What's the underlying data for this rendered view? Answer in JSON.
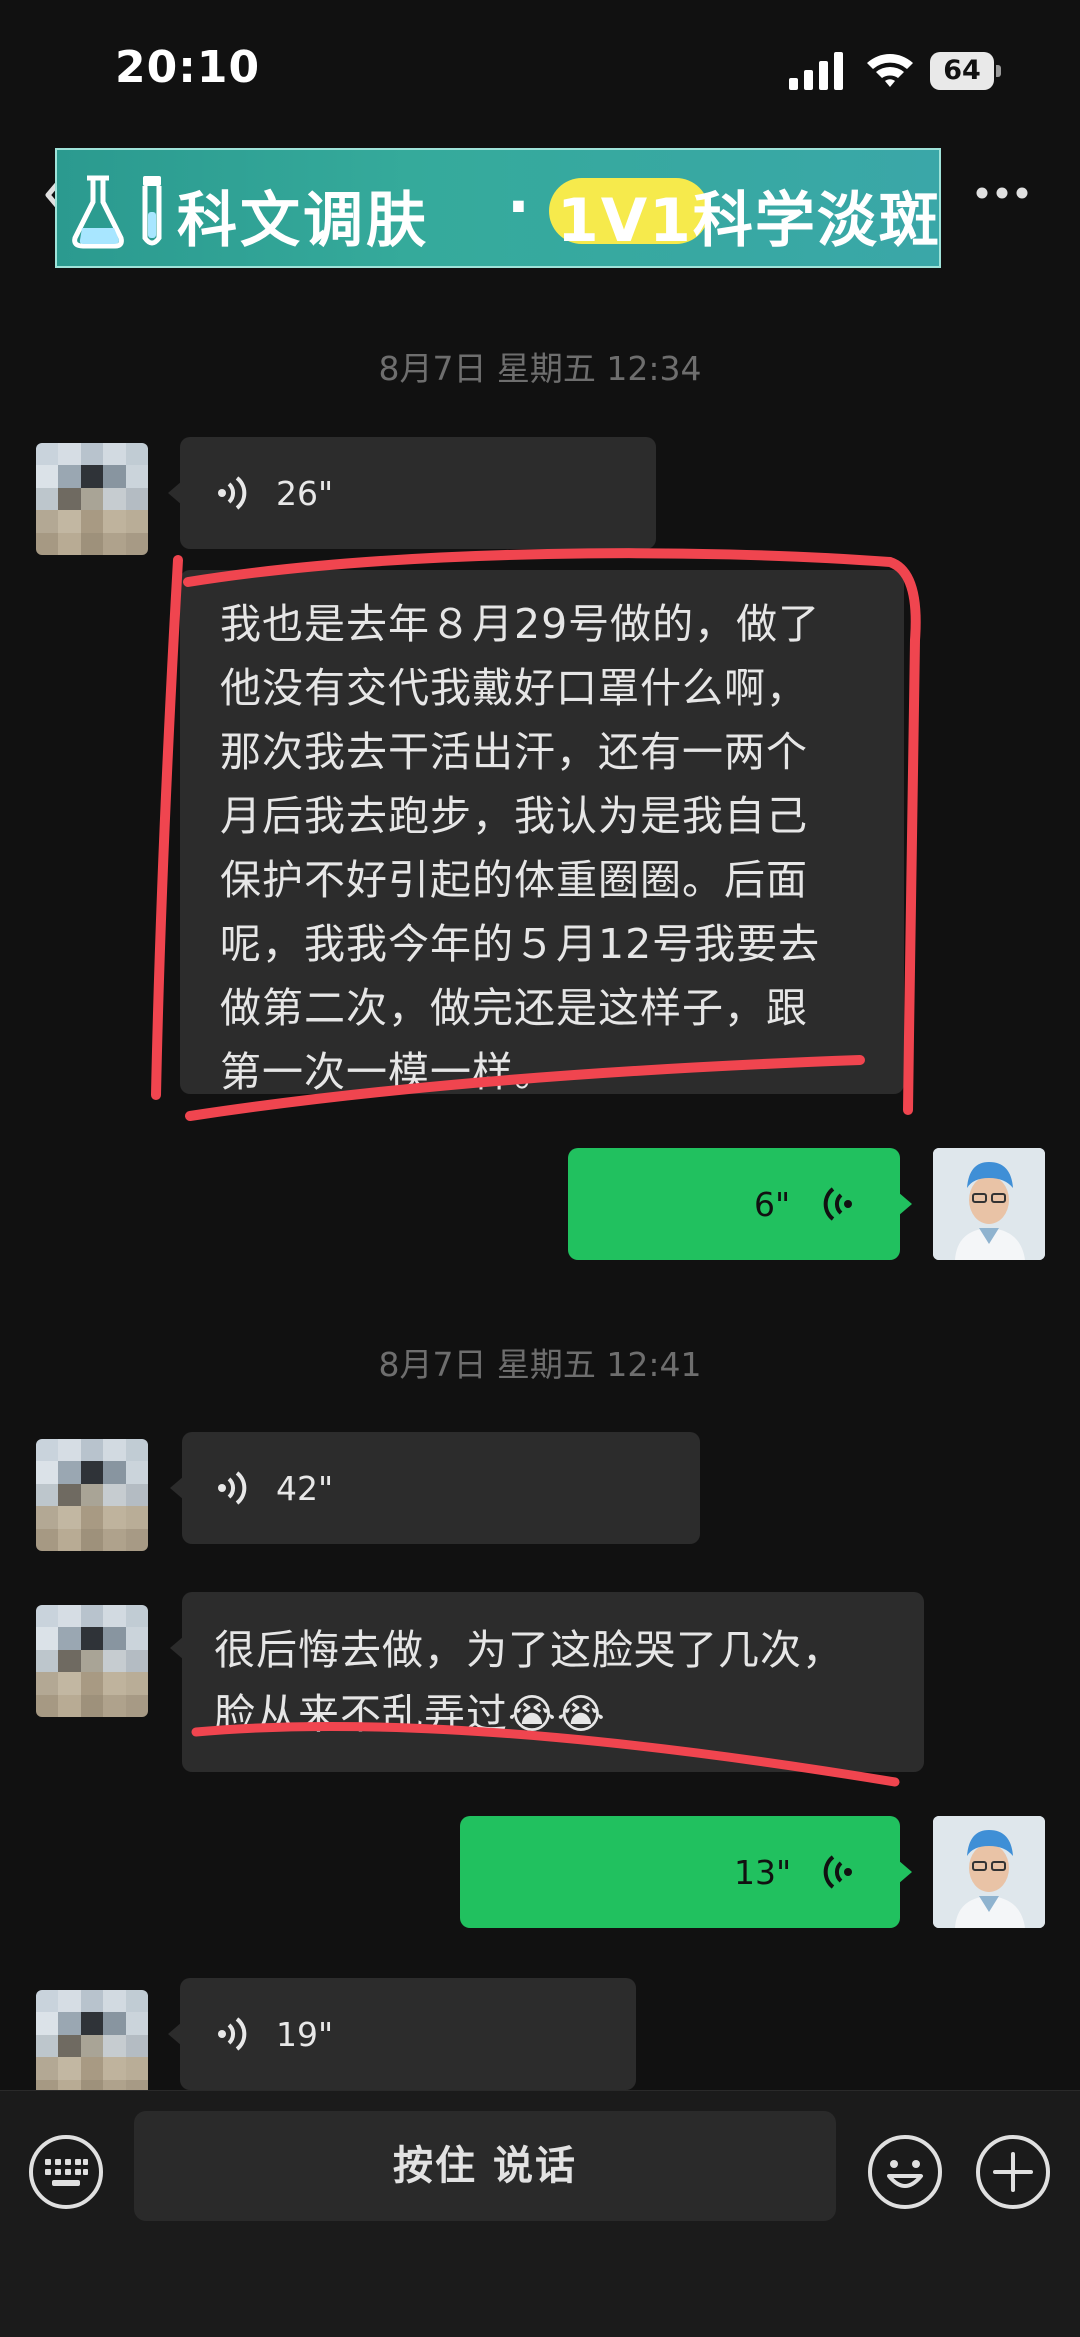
{
  "status_bar": {
    "time": "20:10",
    "battery": "64",
    "icons": [
      "signal-icon",
      "wifi-icon",
      "battery-icon"
    ]
  },
  "header": {
    "back_icon": "chevron-left-icon",
    "banner_title": "科文调肤",
    "banner_dot": "·",
    "banner_subtitle": "1V1科学淡斑",
    "more_icon": "more-dots-icon"
  },
  "chat": {
    "timestamps": [
      "8月7日 星期五 12:34",
      "8月7日 星期五 12:41"
    ],
    "messages": [
      {
        "from": "other",
        "kind": "voice",
        "duration": "26\""
      },
      {
        "from": "other",
        "kind": "text",
        "text": "我也是去年８月29号做的，做了\n他没有交代我戴好口罩什么啊，\n那次我去干活出汗，还有一两个\n月后我去跑步，我认为是我自己\n保护不好引起的体重圈圈。后面\n呢，我我今年的５月12号我要去\n做第二次，做完还是这样子，跟\n第一次一模一样。"
      },
      {
        "from": "self",
        "kind": "voice",
        "duration": "6\""
      },
      {
        "from": "other",
        "kind": "voice",
        "duration": "42\""
      },
      {
        "from": "other",
        "kind": "text",
        "text": "很后悔去做，为了这脸哭了几次，\n脸从来不乱弄过😭😭"
      },
      {
        "from": "self",
        "kind": "voice",
        "duration": "13\""
      },
      {
        "from": "other",
        "kind": "voice",
        "duration": "19\""
      }
    ]
  },
  "input_bar": {
    "keyboard_icon": "keyboard-icon",
    "hold_to_talk": "按住 说话",
    "emoji_icon": "emoji-icon",
    "plus_icon": "plus-icon"
  },
  "colors": {
    "background": "#111111",
    "bubble_received": "#2c2c2c",
    "bubble_sent": "#21c15f",
    "annotation": "#f0454f",
    "banner": "#35aa9b",
    "banner_highlight": "#f6ea4c"
  }
}
